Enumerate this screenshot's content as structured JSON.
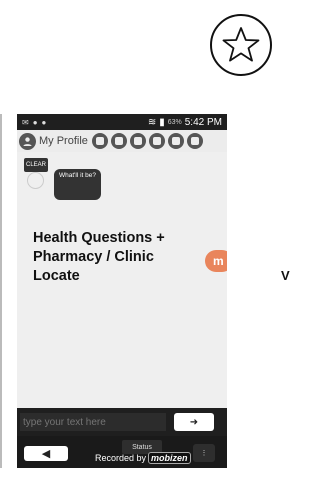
{
  "status_bar": {
    "time": "5:42 PM",
    "battery": "63%"
  },
  "top_bar": {
    "profile_label": "My Profile"
  },
  "chat": {
    "clear_label": "CLEAR",
    "bubble_text": "What'll it be?"
  },
  "headline": "Health Questions + Pharmacy / Clinic Locate",
  "input": {
    "placeholder": "type your text here"
  },
  "bottom": {
    "status_label": "Status",
    "recorded_by": "Recorded by",
    "brand": "mobizen"
  },
  "side_letter": "V",
  "colors": {
    "accent_orange": "#e9855c",
    "phone_dark": "#1f1f1f",
    "content_bg": "#efefef"
  }
}
